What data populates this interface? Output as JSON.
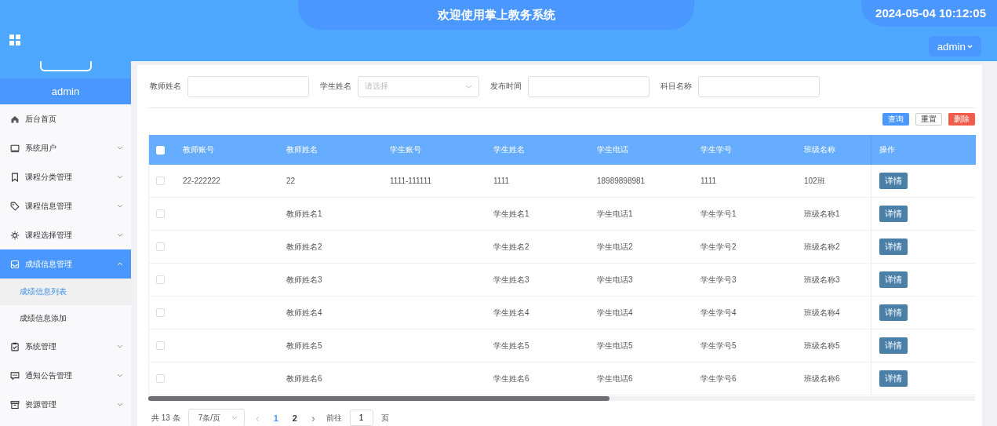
{
  "header": {
    "title": "欢迎使用掌上教务系统",
    "datetime": "2024-05-04 10:12:05",
    "user_menu": "admin"
  },
  "sidebar": {
    "user": "admin",
    "items": [
      {
        "label": "后台首页",
        "kind": "link",
        "selected": false
      },
      {
        "label": "系统用户",
        "kind": "group",
        "expanded": false,
        "selected": false
      },
      {
        "label": "课程分类管理",
        "kind": "group",
        "expanded": false,
        "selected": false
      },
      {
        "label": "课程信息管理",
        "kind": "group",
        "expanded": false,
        "selected": false
      },
      {
        "label": "课程选择管理",
        "kind": "group",
        "expanded": false,
        "selected": false
      },
      {
        "label": "成绩信息管理",
        "kind": "group",
        "expanded": true,
        "selected": true,
        "children": [
          {
            "label": "成绩信息列表",
            "selected": true
          },
          {
            "label": "成绩信息添加",
            "selected": false
          }
        ]
      },
      {
        "label": "系统管理",
        "kind": "group",
        "expanded": false,
        "selected": false
      },
      {
        "label": "通知公告管理",
        "kind": "group",
        "expanded": false,
        "selected": false
      },
      {
        "label": "资源管理",
        "kind": "group",
        "expanded": false,
        "selected": false
      }
    ]
  },
  "search": {
    "fields": [
      {
        "label": "教师姓名",
        "kind": "text"
      },
      {
        "label": "学生姓名",
        "kind": "select",
        "placeholder": "请选择"
      },
      {
        "label": "发布时间",
        "kind": "text"
      },
      {
        "label": "科目名称",
        "kind": "text"
      }
    ],
    "buttons": [
      {
        "label": "查询",
        "kind": "primary"
      },
      {
        "label": "重置",
        "kind": "plain"
      },
      {
        "label": "删除",
        "kind": "danger"
      }
    ]
  },
  "table": {
    "all_checked": false,
    "columns": [
      "教师账号",
      "教师姓名",
      "学生账号",
      "学生姓名",
      "学生电话",
      "学生学号",
      "班级名称",
      "操作"
    ],
    "rows": [
      {
        "checked": false,
        "cells": [
          "22-222222",
          "22",
          "1111-111111",
          "1111",
          "18989898981",
          "1111",
          "102班"
        ],
        "action": "详情"
      },
      {
        "checked": false,
        "cells": [
          "",
          "教师姓名1",
          "",
          "学生姓名1",
          "学生电话1",
          "学生学号1",
          "班级名称1"
        ],
        "action": "详情"
      },
      {
        "checked": false,
        "cells": [
          "",
          "教师姓名2",
          "",
          "学生姓名2",
          "学生电话2",
          "学生学号2",
          "班级名称2"
        ],
        "action": "详情"
      },
      {
        "checked": false,
        "cells": [
          "",
          "教师姓名3",
          "",
          "学生姓名3",
          "学生电话3",
          "学生学号3",
          "班级名称3"
        ],
        "action": "详情"
      },
      {
        "checked": false,
        "cells": [
          "",
          "教师姓名4",
          "",
          "学生姓名4",
          "学生电话4",
          "学生学号4",
          "班级名称4"
        ],
        "action": "详情"
      },
      {
        "checked": false,
        "cells": [
          "",
          "教师姓名5",
          "",
          "学生姓名5",
          "学生电话5",
          "学生学号5",
          "班级名称5"
        ],
        "action": "详情"
      },
      {
        "checked": false,
        "cells": [
          "",
          "教师姓名6",
          "",
          "学生姓名6",
          "学生电话6",
          "学生学号6",
          "班级名称6"
        ],
        "action": "详情"
      }
    ]
  },
  "pagination": {
    "total": "共 13 条",
    "page_size": "7条/页",
    "prev": "‹",
    "pages": [
      {
        "label": "1",
        "selected": true
      },
      {
        "label": "2",
        "selected": false
      }
    ],
    "next": "›",
    "goto": "前往",
    "goto_value": "1",
    "page_unit": "页"
  }
}
